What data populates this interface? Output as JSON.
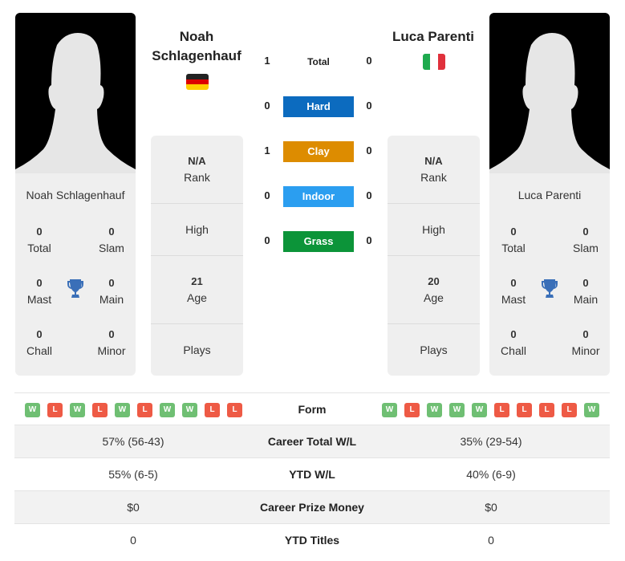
{
  "player1": {
    "name": "Noah Schlagenhauf",
    "name_line1": "Noah",
    "name_line2": "Schlagenhauf",
    "country": "Germany",
    "flag_colors": [
      "#222222",
      "#dd0000",
      "#ffce00"
    ],
    "titles": {
      "total": {
        "value": "0",
        "label": "Total"
      },
      "slam": {
        "value": "0",
        "label": "Slam"
      },
      "mast": {
        "value": "0",
        "label": "Mast"
      },
      "main": {
        "value": "0",
        "label": "Main"
      },
      "chall": {
        "value": "0",
        "label": "Chall"
      },
      "minor": {
        "value": "0",
        "label": "Minor"
      }
    },
    "info": {
      "rank_value": "N/A",
      "rank_label": "Rank",
      "high_label": "High",
      "age_value": "21",
      "age_label": "Age",
      "plays_label": "Plays"
    },
    "form": [
      "W",
      "L",
      "W",
      "L",
      "W",
      "L",
      "W",
      "W",
      "L",
      "L"
    ]
  },
  "player2": {
    "name": "Luca Parenti",
    "country": "Italy",
    "flag_colors": [
      "#1eaa4e",
      "#ffffff",
      "#e0313c"
    ],
    "titles": {
      "total": {
        "value": "0",
        "label": "Total"
      },
      "slam": {
        "value": "0",
        "label": "Slam"
      },
      "mast": {
        "value": "0",
        "label": "Mast"
      },
      "main": {
        "value": "0",
        "label": "Main"
      },
      "chall": {
        "value": "0",
        "label": "Chall"
      },
      "minor": {
        "value": "0",
        "label": "Minor"
      }
    },
    "info": {
      "rank_value": "N/A",
      "rank_label": "Rank",
      "high_label": "High",
      "age_value": "20",
      "age_label": "Age",
      "plays_label": "Plays"
    },
    "form": [
      "W",
      "L",
      "W",
      "W",
      "W",
      "L",
      "L",
      "L",
      "L",
      "W"
    ]
  },
  "h2h": {
    "total": {
      "label": "Total",
      "p1": "1",
      "p2": "0"
    },
    "surfaces": [
      {
        "label": "Hard",
        "p1": "0",
        "p2": "0",
        "color": "#0c6bbf"
      },
      {
        "label": "Clay",
        "p1": "1",
        "p2": "0",
        "color": "#dd8c00"
      },
      {
        "label": "Indoor",
        "p1": "0",
        "p2": "0",
        "color": "#2b9ef0"
      },
      {
        "label": "Grass",
        "p1": "0",
        "p2": "0",
        "color": "#0c9439"
      }
    ]
  },
  "form_label": "Form",
  "form_colors": {
    "W": "#6fbf73",
    "L": "#ee5a45"
  },
  "trophy_color": "#3a6fb8",
  "stats": [
    {
      "label": "Career Total W/L",
      "p1": "57% (56-43)",
      "p2": "35% (29-54)"
    },
    {
      "label": "YTD W/L",
      "p1": "55% (6-5)",
      "p2": "40% (6-9)"
    },
    {
      "label": "Career Prize Money",
      "p1": "$0",
      "p2": "$0"
    },
    {
      "label": "YTD Titles",
      "p1": "0",
      "p2": "0"
    }
  ]
}
